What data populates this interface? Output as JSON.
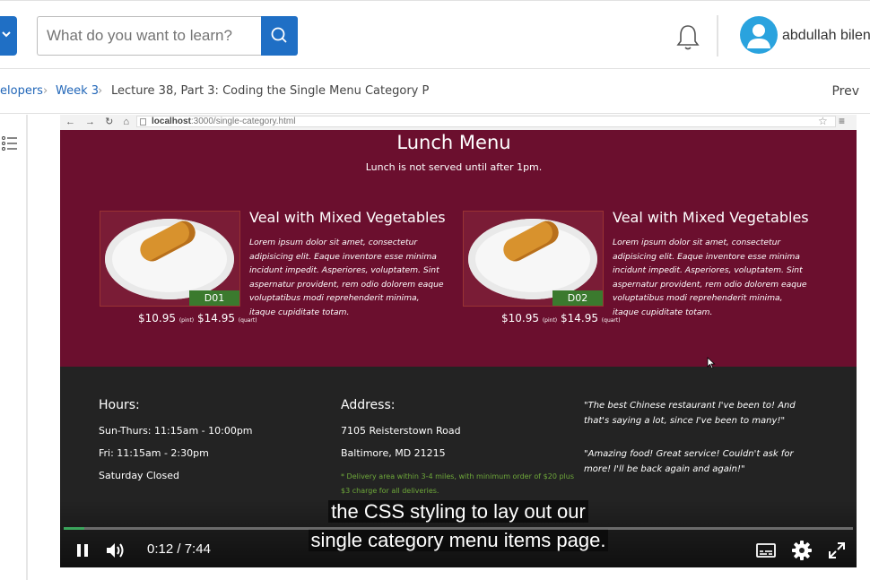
{
  "header": {
    "search_placeholder": "What do you want to learn?",
    "username": "abdullah bilen"
  },
  "breadcrumb": {
    "items": [
      "elopers",
      "Week 3",
      "Lecture 38, Part 3: Coding the Single Menu Category P"
    ],
    "prev_label": "Prev"
  },
  "video": {
    "browser_url_host": "localhost",
    "browser_url_path": ":3000/single-category.html",
    "page": {
      "title": "Lunch Menu",
      "subtitle": "Lunch is not served until after 1pm.",
      "items": [
        {
          "name": "Veal with Mixed Vegetables",
          "description": "Lorem ipsum dolor sit amet, consectetur adipisicing elit. Eaque inventore esse minima incidunt impedit. Asperiores, voluptatem. Sint aspernatur provident, rem odio dolorem eaque voluptatibus modi reprehenderit minima, itaque cupiditate totam.",
          "code": "D01",
          "price_pint": "$10.95",
          "pint_label": "(pint)",
          "price_quart": "$14.95",
          "quart_label": "(quart)"
        },
        {
          "name": "Veal with Mixed Vegetables",
          "description": "Lorem ipsum dolor sit amet, consectetur adipisicing elit. Eaque inventore esse minima incidunt impedit. Asperiores, voluptatem. Sint aspernatur provident, rem odio dolorem eaque voluptatibus modi reprehenderit minima, itaque cupiditate totam.",
          "code": "D02",
          "price_pint": "$10.95",
          "pint_label": "(pint)",
          "price_quart": "$14.95",
          "quart_label": "(quart)"
        }
      ],
      "hours": {
        "heading": "Hours:",
        "lines": [
          "Sun-Thurs: 11:15am - 10:00pm",
          "Fri: 11:15am - 2:30pm",
          "Saturday Closed"
        ]
      },
      "address": {
        "heading": "Address:",
        "lines": [
          "7105 Reisterstown Road",
          "Baltimore, MD 21215"
        ],
        "note": "* Delivery area within 3-4 miles, with minimum order of $20 plus $3 charge for all deliveries."
      },
      "testimonials": [
        "\"The best Chinese restaurant I've been to! And that's saying a lot, since I've been to many!\"",
        "\"Amazing food! Great service! Couldn't ask for more! I'll be back again and again!\""
      ]
    },
    "caption_line1": "the CSS styling to lay out our",
    "caption_line2": "single category menu items page.",
    "current_time": "0:12",
    "time_separator": "/",
    "duration": "7:44",
    "progress_fraction": 0.026
  },
  "colors": {
    "accent": "#1f6fc5",
    "menu_bg": "#6b0f2e",
    "footer_bg": "#232323",
    "progress": "#3ba55c"
  },
  "icons": [
    "chevron-down-icon",
    "search-icon",
    "bell-icon",
    "user-avatar-icon",
    "list-icon",
    "pause-icon",
    "volume-icon",
    "captions-icon",
    "gear-icon",
    "fullscreen-icon"
  ]
}
